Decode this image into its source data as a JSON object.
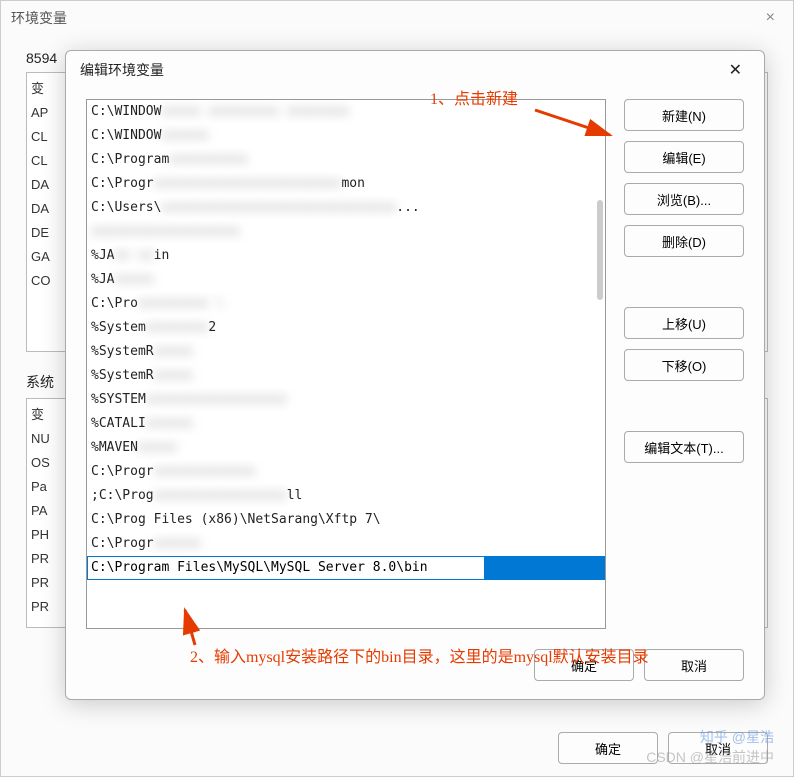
{
  "outer": {
    "title": "环境变量",
    "user_section_prefix": "8594",
    "user_labels": [
      "变",
      "AP",
      "CL",
      "CL",
      "DA",
      "DA",
      "DE",
      "GA",
      "CO"
    ],
    "system_section_label": "系统",
    "system_labels": [
      "变",
      "NU",
      "OS",
      "Pa",
      "PA",
      "PH",
      "PR",
      "PR",
      "PR"
    ],
    "ok": "确定",
    "cancel": "取消"
  },
  "inner": {
    "title": "编辑环境变量",
    "paths": [
      "C:\\WINDOW",
      "C:\\WINDOW",
      "C:\\Program",
      "C:\\Progr",
      "C:\\Users\\",
      "",
      "%JA",
      "%JA",
      "C:\\Pro",
      "%System",
      "%SystemR",
      "%SystemR",
      "%SYSTEM",
      "%CATALI",
      "%MAVEN",
      "C:\\Progr",
      ";C:\\Prog",
      "C:\\Prog       Files (x86)\\NetSarang\\Xftp 7\\",
      "C:\\Progr"
    ],
    "path_tails": [
      "mon",
      "...",
      "in",
      "2",
      "ll"
    ],
    "selected_path": "C:\\Program Files\\MySQL\\MySQL Server 8.0\\bin",
    "buttons": {
      "new": "新建(N)",
      "edit": "编辑(E)",
      "browse": "浏览(B)...",
      "delete": "删除(D)",
      "moveup": "上移(U)",
      "movedown": "下移(O)",
      "edittext": "编辑文本(T)..."
    },
    "ok": "确定",
    "cancel": "取消"
  },
  "annotations": {
    "a1": "1、点击新建",
    "a2": "2、输入mysql安装路径下的bin目录，这里的是mysql默认安装目录"
  },
  "watermarks": {
    "w1": "知乎 @星浩",
    "w2": "CSDN @星浩前进中"
  }
}
